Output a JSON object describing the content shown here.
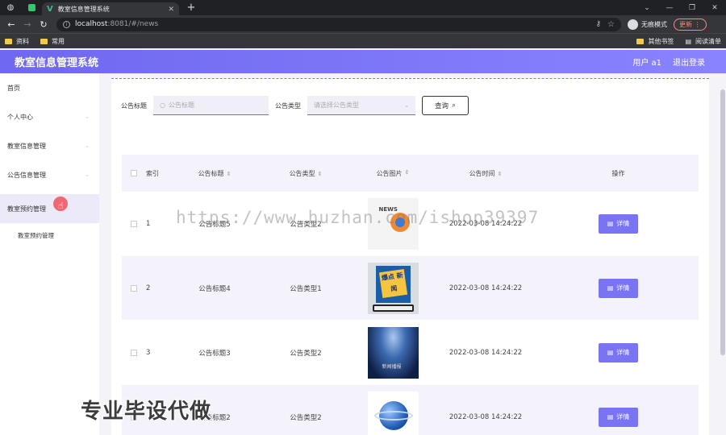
{
  "browser": {
    "tab_title": "教室信息管理系统",
    "url_host": "localhost",
    "url_path": ":8081/#/news",
    "incognito_label": "无痕模式",
    "update_label": "更新",
    "bookmarks_left": [
      "资料",
      "常用"
    ],
    "bookmarks_right": [
      "其他书签",
      "阅读清单"
    ]
  },
  "header": {
    "title": "教室信息管理系统",
    "user": "用户 a1",
    "logout": "退出登录"
  },
  "sidebar": {
    "items": [
      {
        "label": "首页"
      },
      {
        "label": "个人中心"
      },
      {
        "label": "教室信息管理"
      },
      {
        "label": "公告信息管理"
      },
      {
        "label": "教室预约管理"
      }
    ],
    "subitem": "教室预约管理"
  },
  "search": {
    "title_label": "公告标题",
    "title_placeholder": "公告标题",
    "type_label": "公告类型",
    "type_placeholder": "请选择公告类型",
    "query_label": "查询"
  },
  "table": {
    "headers": {
      "index": "索引",
      "title": "公告标题",
      "type": "公告类型",
      "image": "公告图片",
      "time": "公告时间",
      "op": "操作"
    },
    "rows": [
      {
        "index": "1",
        "title": "公告标题5",
        "type": "公告类型2",
        "time": "2022-03-08 14:24:22",
        "image": "news-image"
      },
      {
        "index": "2",
        "title": "公告标题4",
        "type": "公告类型1",
        "time": "2022-03-08 14:24:22",
        "image": "hot-news-image",
        "image_text": "爆点 新闻"
      },
      {
        "index": "3",
        "title": "公告标题3",
        "type": "公告类型2",
        "time": "2022-03-08 14:24:22",
        "image": "stage-image",
        "image_text": "新闻播报"
      },
      {
        "index": "",
        "title": "公告标题2",
        "type": "公告类型2",
        "time": "2022-03-08 14:24:22",
        "image": "globe-image"
      }
    ],
    "detail_label": "详情"
  },
  "overlays": {
    "watermark": "https://www.huzhan.com/ishop39397",
    "promo": "专业毕设代做"
  }
}
